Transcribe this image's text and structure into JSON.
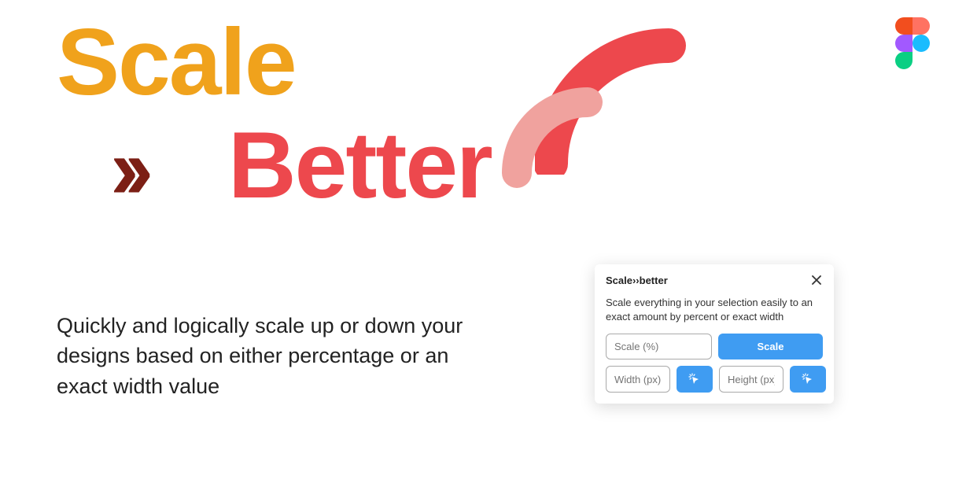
{
  "colors": {
    "orange": "#f0a21c",
    "darkRed": "#7c1f15",
    "coral": "#ed484d",
    "coralLight": "#f0a29e",
    "blue": "#3f9cf2",
    "figma": {
      "orange": "#ff7262",
      "red": "#f24e1e",
      "purple": "#a259ff",
      "blue": "#1abcfe",
      "green": "#0acf83"
    }
  },
  "hero": {
    "scale": "Scale",
    "better": "Better"
  },
  "tagline": "Quickly and logically scale up or down your designs based on either percentage or an exact width value",
  "plugin": {
    "title": "Scale››better",
    "description": "Scale everything in your selection easily to an exact amount by percent or exact width",
    "scalePlaceholder": "Scale (%)",
    "scaleButton": "Scale",
    "widthPlaceholder": "Width (px)",
    "heightPlaceholder": "Height (px)"
  }
}
